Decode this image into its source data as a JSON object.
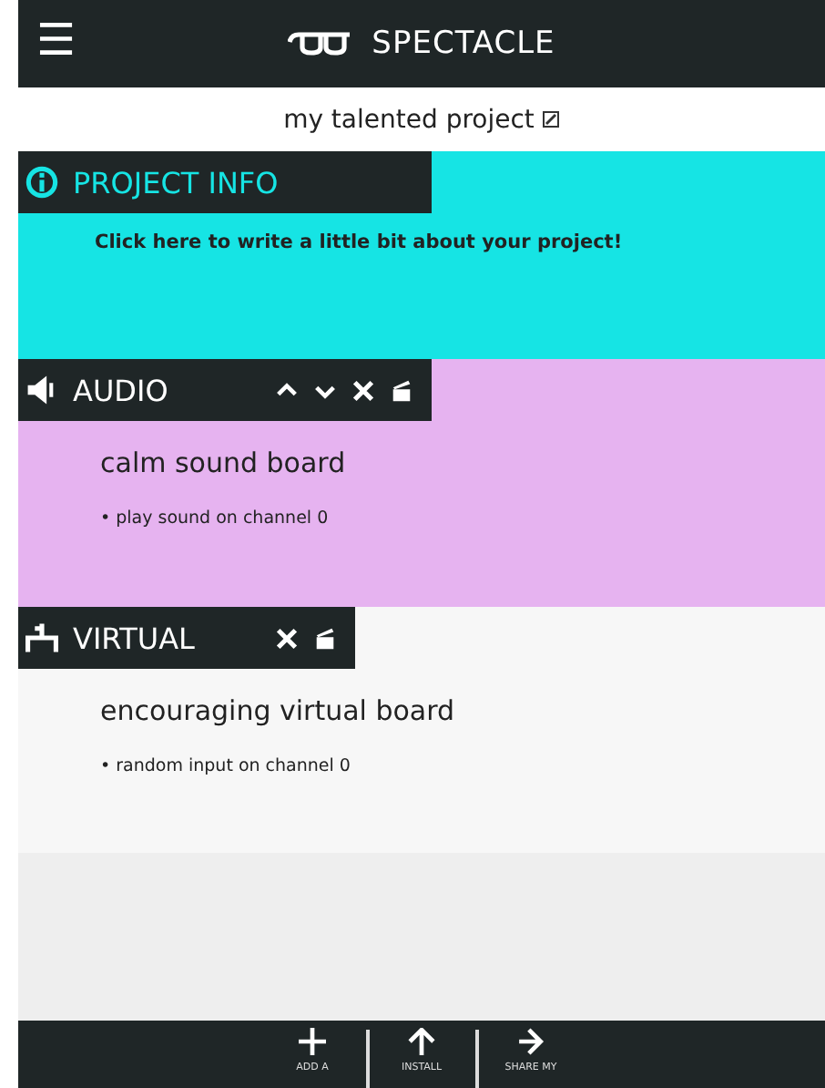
{
  "header": {
    "menu": "☰",
    "title": "SPECTACLE"
  },
  "project": {
    "name": "my talented project"
  },
  "sections": [
    {
      "kind": "info",
      "title": "PROJECT INFO",
      "color": "#16e4e4",
      "description": "Click here to write a little bit about your project!"
    },
    {
      "kind": "audio",
      "title": "AUDIO",
      "color": "#e6b3f0",
      "name": "calm sound board",
      "actions": [
        "• play sound on channel 0"
      ],
      "controls": [
        {
          "kind": "up"
        },
        {
          "kind": "down"
        },
        {
          "kind": "close"
        },
        {
          "kind": "clapper"
        }
      ]
    },
    {
      "kind": "virtual",
      "title": "VIRTUAL",
      "color": "#f7f7f7",
      "name": "encouraging virtual board",
      "actions": [
        "• random input on channel 0"
      ],
      "controls": [
        {
          "kind": "close"
        },
        {
          "kind": "clapper"
        }
      ]
    }
  ],
  "footer": [
    {
      "kind": "add",
      "label": "ADD A"
    },
    {
      "kind": "install",
      "label": "INSTALL"
    },
    {
      "kind": "share",
      "label": "SHARE MY"
    }
  ]
}
